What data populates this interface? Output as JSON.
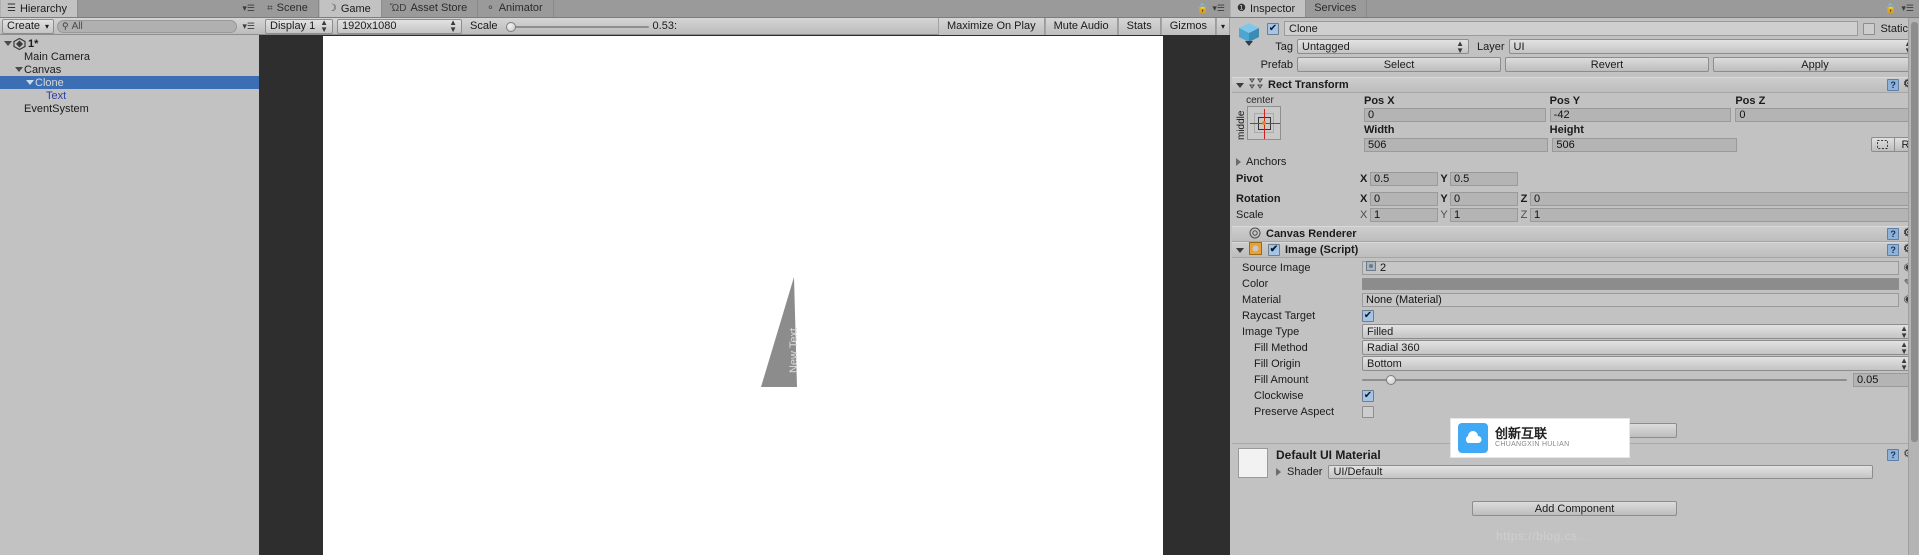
{
  "hierarchy": {
    "tab_label": "Hierarchy",
    "tab_icon": "hierarchy-icon",
    "create_label": "Create",
    "search_placeholder": "All",
    "search_icon": "search-icon",
    "rows": [
      {
        "label": "1*",
        "indent": 0,
        "fold": "down",
        "scene": true,
        "selected": false
      },
      {
        "label": "Main Camera",
        "indent": 1,
        "fold": "none",
        "scene": false,
        "selected": false
      },
      {
        "label": "Canvas",
        "indent": 1,
        "fold": "down",
        "scene": false,
        "selected": false
      },
      {
        "label": "Clone",
        "indent": 2,
        "fold": "down",
        "scene": false,
        "selected": true
      },
      {
        "label": "Text",
        "indent": 3,
        "fold": "none",
        "scene": false,
        "selected": false
      },
      {
        "label": "EventSystem",
        "indent": 1,
        "fold": "none",
        "scene": false,
        "selected": false
      }
    ]
  },
  "gameview": {
    "tabs": [
      {
        "label": "Scene",
        "icon": "grid-icon",
        "active": false
      },
      {
        "label": "Game",
        "icon": "gamepad-icon",
        "active": true
      },
      {
        "label": "Asset Store",
        "icon": "store-icon",
        "active": false
      },
      {
        "label": "Animator",
        "icon": "animator-icon",
        "active": false
      }
    ],
    "display": "Display 1",
    "resolution": "1920x1080",
    "scale_label": "Scale",
    "scale_value": "0.53:",
    "maximize_on_play": "Maximize On Play",
    "mute_audio": "Mute Audio",
    "stats": "Stats",
    "gizmos": "Gizmos",
    "canvas_text": "New Text"
  },
  "inspector": {
    "tabs": [
      {
        "label": "Inspector",
        "active": true
      },
      {
        "label": "Services",
        "active": false
      }
    ],
    "lock_icon": "lock-icon",
    "menu_icon": "menu-icon",
    "object_name": "Clone",
    "object_enabled": true,
    "static_label": "Static",
    "static_checked": false,
    "tag_label": "Tag",
    "tag_value": "Untagged",
    "layer_label": "Layer",
    "layer_value": "UI",
    "prefab_label": "Prefab",
    "prefab_buttons": [
      "Select",
      "Revert",
      "Apply"
    ],
    "rect_transform": {
      "title": "Rect Transform",
      "anchor_preset_top": "center",
      "anchor_preset_side": "middle",
      "pos_labels": [
        "Pos X",
        "Pos Y",
        "Pos Z"
      ],
      "pos_values": [
        "0",
        "-42",
        "0"
      ],
      "size_labels": [
        "Width",
        "Height"
      ],
      "size_values": [
        "506",
        "506"
      ],
      "anchors_label": "Anchors",
      "pivot_label": "Pivot",
      "pivot_axes": [
        "X",
        "Y"
      ],
      "pivot_values": [
        "0.5",
        "0.5"
      ],
      "rotation_label": "Rotation",
      "rotation_axes": [
        "X",
        "Y",
        "Z"
      ],
      "rotation_values": [
        "0",
        "0",
        "0"
      ],
      "scale_label": "Scale",
      "scale_axes": [
        "X",
        "Y",
        "Z"
      ],
      "scale_values": [
        "1",
        "1",
        "1"
      ],
      "blueprint_btn": "blueprint-mode-icon",
      "raw_btn": "R"
    },
    "canvas_renderer": {
      "title": "Canvas Renderer"
    },
    "image_script": {
      "title": "Image (Script)",
      "enabled": true,
      "source_image_label": "Source Image",
      "source_image_value": "2",
      "color_label": "Color",
      "color_value": "#8C8C8C",
      "material_label": "Material",
      "material_value": "None (Material)",
      "raycast_label": "Raycast Target",
      "raycast_checked": true,
      "image_type_label": "Image Type",
      "image_type_value": "Filled",
      "fill_method_label": "Fill Method",
      "fill_method_value": "Radial 360",
      "fill_origin_label": "Fill Origin",
      "fill_origin_value": "Bottom",
      "fill_amount_label": "Fill Amount",
      "fill_amount_value": "0.05",
      "fill_amount_pct": 5,
      "clockwise_label": "Clockwise",
      "clockwise_checked": true,
      "preserve_aspect_label": "Preserve Aspect",
      "preserve_aspect_checked": false,
      "set_native_size": "Set Native Size"
    },
    "material_block": {
      "title": "Default UI Material",
      "shader_label": "Shader",
      "shader_value": "UI/Default"
    },
    "add_component": "Add Component"
  },
  "watermark": {
    "text": "https://blog.cs..."
  },
  "logo_badge": {
    "cn": "创新互联",
    "en": "CHUANGXIN HULIAN",
    "icon": "cloud-icon"
  }
}
